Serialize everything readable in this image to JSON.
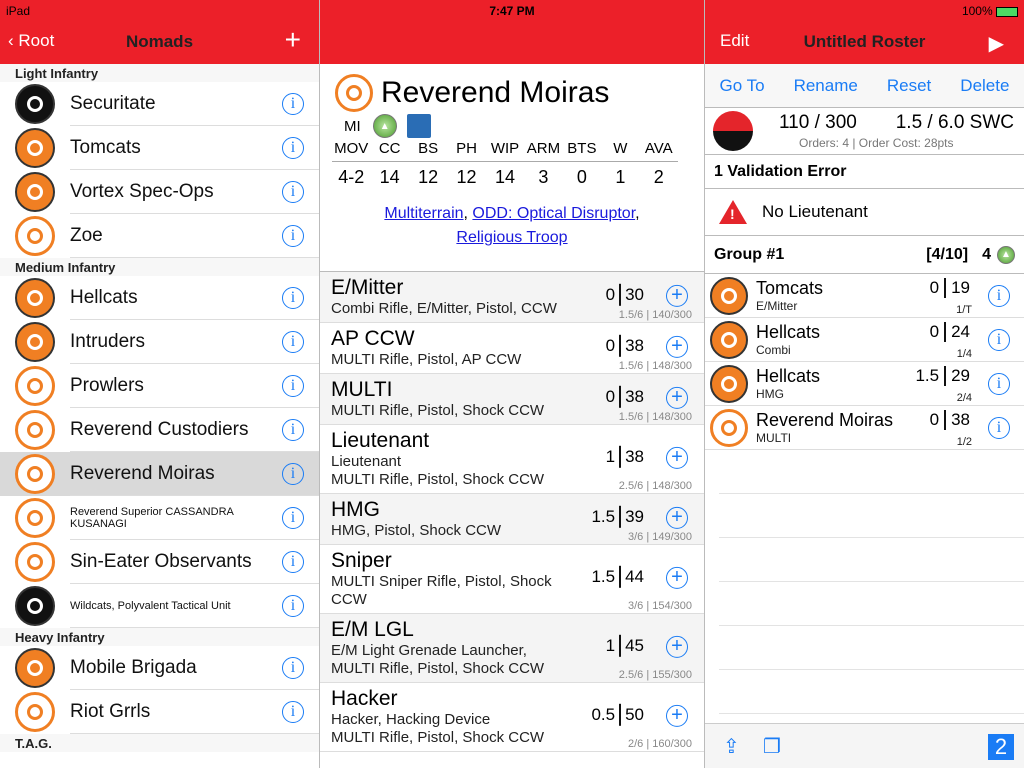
{
  "status": {
    "carrier": "iPad",
    "time": "7:47 PM",
    "battery": "100%"
  },
  "left": {
    "back_label": "Root",
    "title": "Nomads",
    "add_icon": "plus-icon",
    "sections": [
      {
        "title": "Light Infantry",
        "items": [
          {
            "label": "Securitate",
            "logo": "dark"
          },
          {
            "label": "Tomcats",
            "logo": "orange"
          },
          {
            "label": "Vortex Spec-Ops",
            "logo": "orange"
          },
          {
            "label": "Zoe",
            "logo": "light"
          }
        ]
      },
      {
        "title": "Medium Infantry",
        "items": [
          {
            "label": "Hellcats",
            "logo": "orange"
          },
          {
            "label": "Intruders",
            "logo": "orange"
          },
          {
            "label": "Prowlers",
            "logo": "light"
          },
          {
            "label": "Reverend Custodiers",
            "logo": "light"
          },
          {
            "label": "Reverend Moiras",
            "logo": "light",
            "selected": true
          },
          {
            "label": "Reverend Superior CASSANDRA KUSANAGI",
            "logo": "light",
            "small": true
          },
          {
            "label": "Sin-Eater Observants",
            "logo": "light"
          },
          {
            "label": "Wildcats, Polyvalent Tactical Unit",
            "logo": "dark",
            "small": true
          }
        ]
      },
      {
        "title": "Heavy Infantry",
        "items": [
          {
            "label": "Mobile Brigada",
            "logo": "orange"
          },
          {
            "label": "Riot Grrls",
            "logo": "light"
          }
        ]
      },
      {
        "title": "T.A.G.",
        "items": []
      }
    ]
  },
  "profile": {
    "name": "Reverend Moiras",
    "type": "MI",
    "stat_headers": [
      "MOV",
      "CC",
      "BS",
      "PH",
      "WIP",
      "ARM",
      "BTS",
      "W",
      "AVA"
    ],
    "stat_values": [
      "4-2",
      "14",
      "12",
      "12",
      "14",
      "3",
      "0",
      "1",
      "2"
    ],
    "skills": [
      "Multiterrain",
      "ODD: Optical Disruptor",
      "Religious Troop"
    ],
    "options": [
      {
        "name": "E/Mitter",
        "equip": [
          "Combi Rifle, E/Mitter, Pistol, CCW"
        ],
        "swc": "0",
        "pts": "30",
        "sub": "1.5/6 | 140/300"
      },
      {
        "name": "AP CCW",
        "equip": [
          "MULTI Rifle, Pistol, AP CCW"
        ],
        "swc": "0",
        "pts": "38",
        "sub": "1.5/6 | 148/300"
      },
      {
        "name": "MULTI",
        "equip": [
          "MULTI Rifle, Pistol, Shock CCW"
        ],
        "swc": "0",
        "pts": "38",
        "sub": "1.5/6 | 148/300"
      },
      {
        "name": "Lieutenant",
        "equip": [
          "Lieutenant",
          "MULTI Rifle, Pistol, Shock CCW"
        ],
        "swc": "1",
        "pts": "38",
        "sub": "2.5/6 | 148/300"
      },
      {
        "name": "HMG",
        "equip": [
          "HMG, Pistol, Shock CCW"
        ],
        "swc": "1.5",
        "pts": "39",
        "sub": "3/6 | 149/300"
      },
      {
        "name": "Sniper",
        "equip": [
          "MULTI Sniper Rifle, Pistol, Shock CCW"
        ],
        "swc": "1.5",
        "pts": "44",
        "sub": "3/6 | 154/300"
      },
      {
        "name": "E/M LGL",
        "equip": [
          "E/M Light Grenade Launcher,",
          "MULTI Rifle, Pistol, Shock CCW"
        ],
        "swc": "1",
        "pts": "45",
        "sub": "2.5/6 | 155/300"
      },
      {
        "name": "Hacker",
        "equip": [
          "Hacker, Hacking Device",
          "MULTI Rifle, Pistol, Shock CCW"
        ],
        "swc": "0.5",
        "pts": "50",
        "sub": "2/6 | 160/300"
      }
    ]
  },
  "roster": {
    "edit_label": "Edit",
    "title": "Untitled Roster",
    "toolbar": [
      "Go To",
      "Rename",
      "Reset",
      "Delete"
    ],
    "points": "110 / 300",
    "swc": "1.5 / 6.0 SWC",
    "orders": "Orders: 4 | Order Cost: 28pts",
    "validation_title": "1 Validation Error",
    "error": "No Lieutenant",
    "group": {
      "title": "Group #1",
      "count": "[4/10]",
      "orders": "4"
    },
    "units": [
      {
        "name": "Tomcats",
        "weapon": "E/Mitter",
        "swc": "0",
        "pts": "19",
        "sub": "1/T",
        "logo": "orange"
      },
      {
        "name": "Hellcats",
        "weapon": "Combi",
        "swc": "0",
        "pts": "24",
        "sub": "1/4",
        "logo": "orange"
      },
      {
        "name": "Hellcats",
        "weapon": "HMG",
        "swc": "1.5",
        "pts": "29",
        "sub": "2/4",
        "logo": "orange"
      },
      {
        "name": "Reverend Moiras",
        "weapon": "MULTI",
        "swc": "0",
        "pts": "38",
        "sub": "1/2",
        "logo": "light"
      }
    ],
    "page_badge": "2"
  },
  "colors": {
    "nav": "#ec2029",
    "accent": "#1a7cf5",
    "link": "#1a1adc"
  }
}
